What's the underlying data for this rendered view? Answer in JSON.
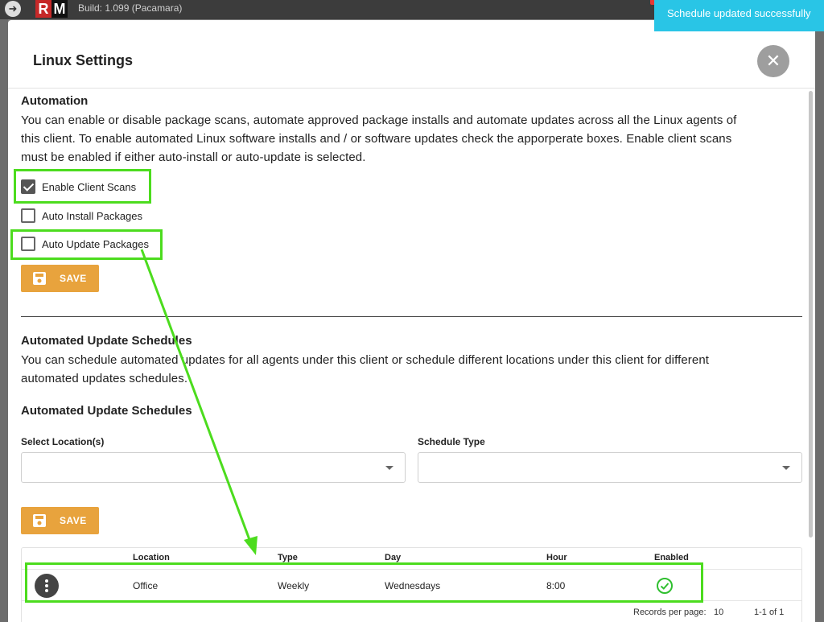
{
  "app": {
    "back_icon": "arrow-left-icon",
    "logo_r": "R",
    "logo_m": "M",
    "build": "Build: 1.099 (Pacamara)"
  },
  "toast": {
    "message": "Schedule updated successfully",
    "color": "#29c5e6"
  },
  "dialog": {
    "title": "Linux Settings",
    "close_icon": "close-icon",
    "automation": {
      "title": "Automation",
      "description_lines": [
        "You can enable or disable package scans, automate approved package installs and automate updates across all the Linux agents of",
        "this client. To enable automated Linux software installs and / or software updates check the apporperate boxes. Enable client scans",
        "must be enabled if either auto-install or auto-update is selected."
      ],
      "checkboxes": [
        {
          "label": "Enable Client Scans",
          "checked": true
        },
        {
          "label": "Auto Install Packages",
          "checked": false
        },
        {
          "label": "Auto Update Packages",
          "checked": false
        }
      ],
      "save_label": "SAVE"
    },
    "schedules": {
      "title": "Automated Update Schedules",
      "description_lines": [
        "You can schedule automated updates for all agents under this client or schedule different locations under this client for different",
        "automated updates schedules."
      ],
      "subtitle": "Automated Update Schedules",
      "location_label": "Select Location(s)",
      "location_value": "",
      "type_label": "Schedule Type",
      "type_value": "",
      "save_label": "SAVE",
      "table": {
        "columns": [
          "Location",
          "Type",
          "Day",
          "Hour",
          "Enabled"
        ],
        "rows": [
          {
            "location": "Office",
            "type": "Weekly",
            "day": "Wednesdays",
            "hour": "8:00",
            "enabled": true
          }
        ],
        "records_per_page_label": "Records per page:",
        "records_per_page": "10",
        "range": "1-1 of 1"
      }
    }
  },
  "colors": {
    "accent_button": "#e8a33d",
    "highlight": "#4cdc1e",
    "enabled_check": "#2fbf2f"
  }
}
